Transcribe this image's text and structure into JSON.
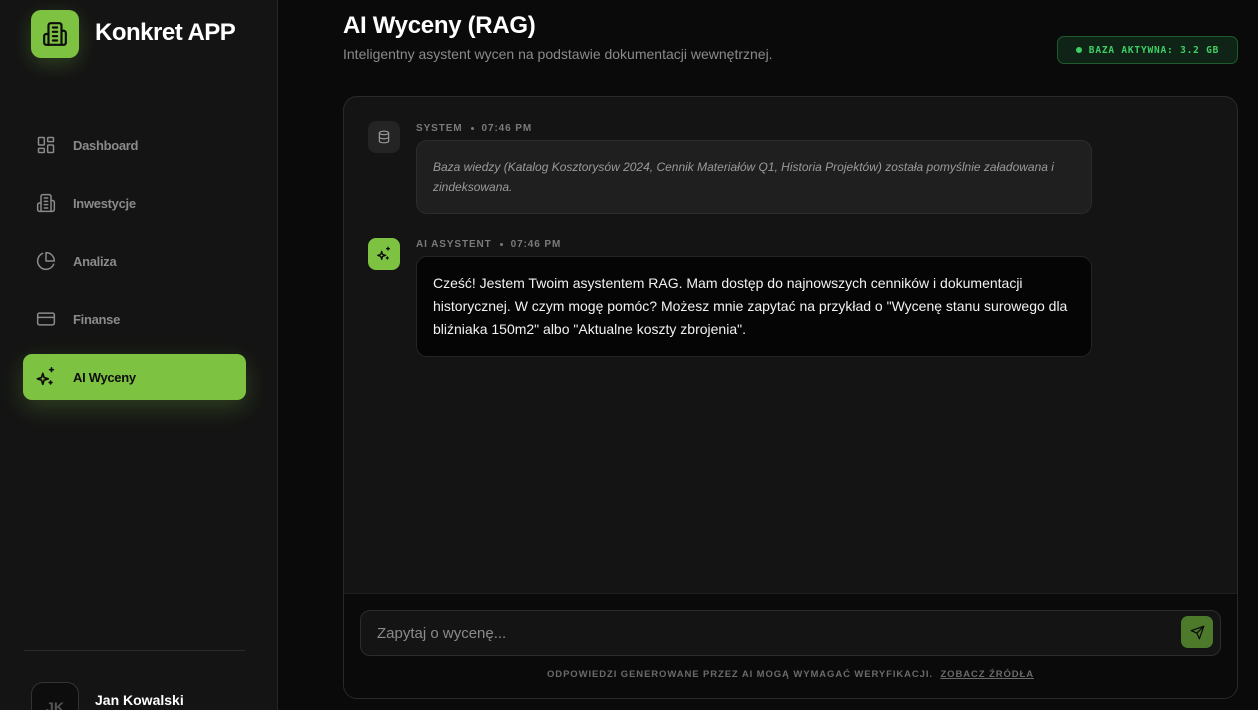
{
  "app": {
    "name": "Konkret APP"
  },
  "colors": {
    "accent": "#7ec242",
    "status_green": "#3fcf64",
    "background": "#0a0a0a",
    "sidebar": "#141414"
  },
  "sidebar": {
    "items": [
      {
        "label": "Dashboard",
        "icon": "dashboard-grid-icon",
        "active": false
      },
      {
        "label": "Inwestycje",
        "icon": "building-icon",
        "active": false
      },
      {
        "label": "Analiza",
        "icon": "pie-chart-icon",
        "active": false
      },
      {
        "label": "Finanse",
        "icon": "credit-card-icon",
        "active": false
      },
      {
        "label": "AI Wyceny",
        "icon": "sparkles-icon",
        "active": true
      }
    ],
    "user": {
      "initials": "JK",
      "name": "Jan Kowalski"
    }
  },
  "header": {
    "title": "AI Wyceny (RAG)",
    "subtitle": "Inteligentny asystent wycen na podstawie dokumentacji wewnętrznej.",
    "status_badge": "BAZA AKTYWNA: 3.2 GB"
  },
  "chat": {
    "messages": [
      {
        "sender": "SYSTEM",
        "time": "07:46 PM",
        "icon": "database-icon",
        "text": "Baza wiedzy (Katalog Kosztorysów 2024, Cennik Materiałów Q1, Historia Projektów) została pomyślnie załadowana i zindeksowana."
      },
      {
        "sender": "AI ASYSTENT",
        "time": "07:46 PM",
        "icon": "sparkles-icon",
        "text": "Cześć! Jestem Twoim asystentem RAG. Mam dostęp do najnowszych cenników i dokumentacji historycznej. W czym mogę pomóc? Możesz mnie zapytać na przykład o \"Wycenę stanu surowego dla bliźniaka 150m2\" albo \"Aktualne koszty zbrojenia\"."
      }
    ],
    "input": {
      "placeholder": "Zapytaj o wycenę...",
      "value": ""
    },
    "disclaimer": "ODPOWIEDZI GENEROWANE PRZEZ AI MOGĄ WYMAGAĆ WERYFIKACJI.",
    "sources_link": "ZOBACZ ŹRÓDŁA"
  }
}
